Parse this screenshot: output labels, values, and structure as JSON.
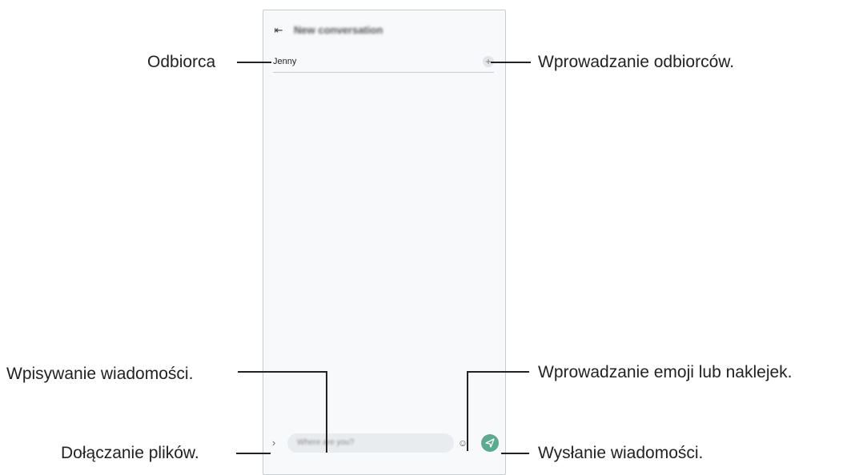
{
  "phone": {
    "title": "New conversation",
    "recipient": "Jenny",
    "add_icon": "+",
    "input_placeholder": "Where are you?",
    "emoji_icon": "smiley-icon",
    "send_icon": "send-icon"
  },
  "callouts": {
    "recipient": "Odbiorca",
    "add_recipients": "Wprowadzanie odbiorców.",
    "type_message": "Wpisywanie wiadomości.",
    "emoji": "Wprowadzanie emoji lub naklejek.",
    "attach": "Dołączanie plików.",
    "send": "Wysłanie wiadomości."
  },
  "colors": {
    "send_button": "#5daa8f",
    "screen_bg": "#f7f9fb"
  }
}
